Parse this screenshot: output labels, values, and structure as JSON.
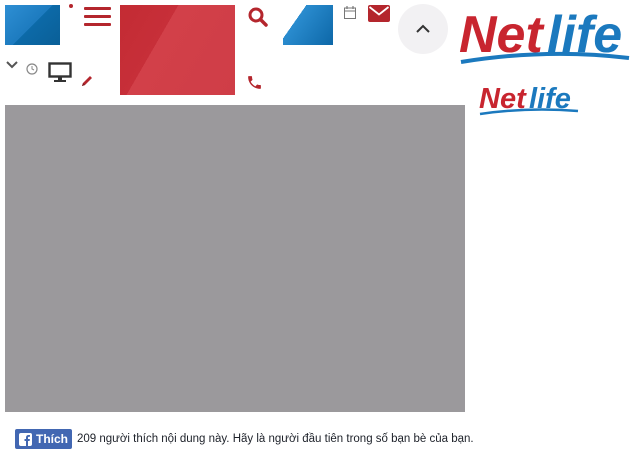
{
  "brand": {
    "logo_text_net": "Net",
    "logo_text_life": "life",
    "primary_red": "#c8252f",
    "primary_blue": "#1b79be"
  },
  "header": {
    "icons": [
      "menu-icon",
      "chevron-down-icon",
      "clock-icon",
      "monitor-icon",
      "pencil-icon",
      "search-icon",
      "phone-icon",
      "calendar-icon",
      "mail-icon",
      "chevron-up-icon"
    ]
  },
  "video": {
    "placeholder_color": "#9b999c"
  },
  "facebook": {
    "like_label": "Thích",
    "like_text": "209 người thích nội dung này. Hãy là người đầu tiên trong số bạn bè của bạn."
  }
}
